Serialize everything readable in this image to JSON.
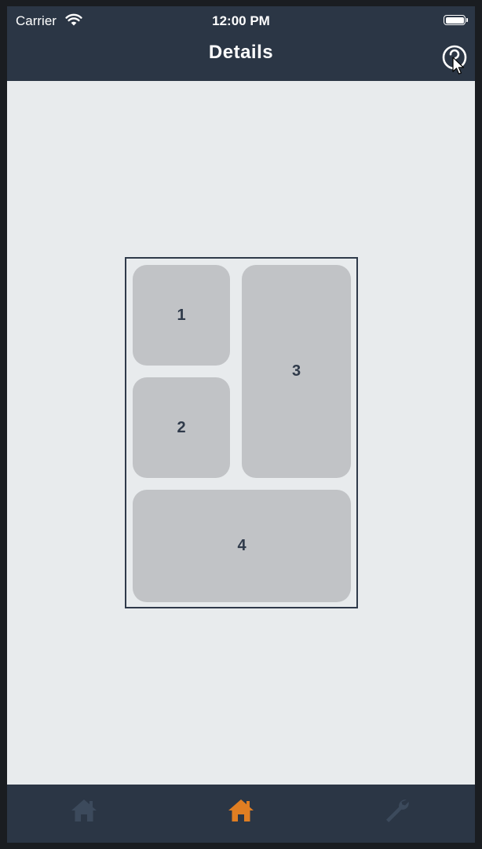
{
  "status_bar": {
    "carrier": "Carrier",
    "time": "12:00 PM",
    "wifi_icon": "wifi-icon",
    "battery_icon": "battery-icon"
  },
  "nav": {
    "title": "Details",
    "help_icon": "question-circle-icon"
  },
  "layout": {
    "tiles": [
      {
        "label": "1"
      },
      {
        "label": "2"
      },
      {
        "label": "3"
      },
      {
        "label": "4"
      }
    ]
  },
  "tabbar": {
    "items": [
      {
        "icon": "home-icon",
        "active": false
      },
      {
        "icon": "home-icon",
        "active": true
      },
      {
        "icon": "wrench-icon",
        "active": false
      }
    ]
  },
  "colors": {
    "bar_background": "#2b3645",
    "content_background": "#e8ebed",
    "tile": "#c1c3c6",
    "tile_text": "#2f3a4a",
    "tab_active": "#e07e22",
    "tab_inactive": "#3c4a5c"
  }
}
